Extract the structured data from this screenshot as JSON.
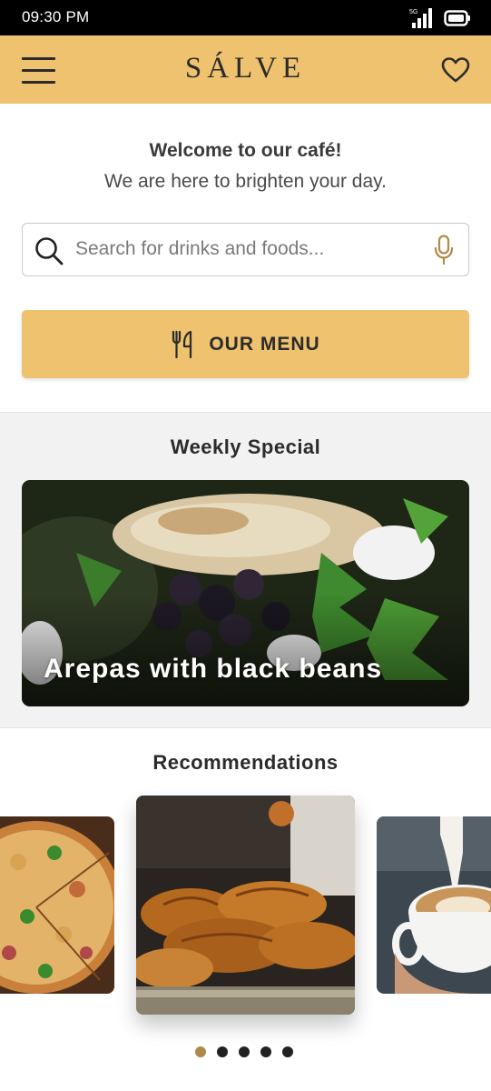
{
  "status_bar": {
    "time": "09:30 PM",
    "network": "5G"
  },
  "header": {
    "brand": "SÁLVE",
    "menu_icon": "hamburger-icon",
    "favorite_icon": "heart-icon"
  },
  "welcome": {
    "title": "Welcome to our café!",
    "subtitle": "We are here to brighten your day."
  },
  "search": {
    "placeholder": "Search for drinks and foods...",
    "value": "",
    "icon": "search-icon",
    "voice_icon": "microphone-icon"
  },
  "menu_button": {
    "label": "OUR MENU",
    "icon": "fork-knife-icon"
  },
  "weekly_special": {
    "title": "Weekly Special",
    "item": "Arepas with black beans"
  },
  "recommendations": {
    "title": "Recommendations",
    "items": [
      "pizza",
      "croissants",
      "latte"
    ],
    "page_count": 5,
    "active_page": 1
  },
  "colors": {
    "accent": "#EFC26F",
    "active_dot": "#B08A4A",
    "text_dark": "#2B2B2B"
  }
}
